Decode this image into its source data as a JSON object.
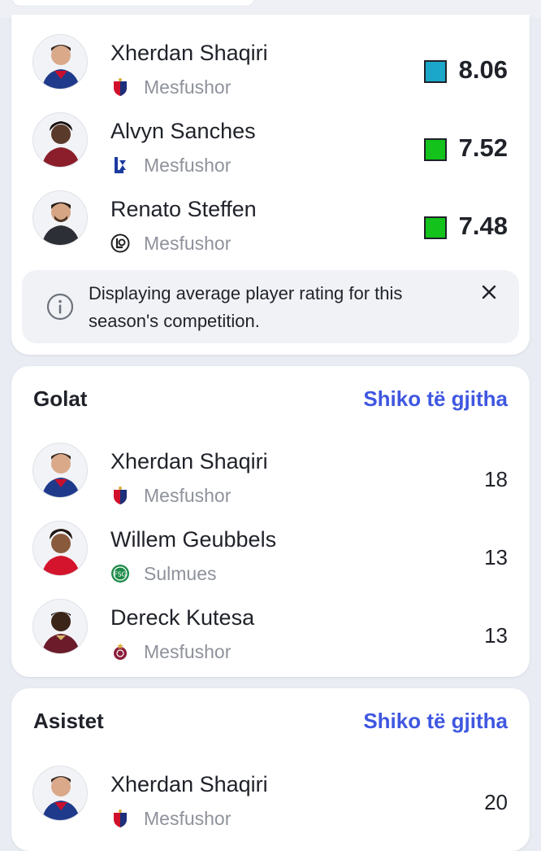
{
  "colors": {
    "accent": "#3f57e0",
    "rating_blue": "#1aa7c9",
    "rating_green": "#13c21b"
  },
  "rating_card": {
    "players": [
      {
        "name": "Xherdan Shaqiri",
        "position": "Mesfushor",
        "rating": "8.06",
        "rating_color": "#1aa7c9",
        "badge": "basel-badge-icon"
      },
      {
        "name": "Alvyn Sanches",
        "position": "Mesfushor",
        "rating": "7.52",
        "rating_color": "#13c21b",
        "badge": "lausanne-badge-icon"
      },
      {
        "name": "Renato Steffen",
        "position": "Mesfushor",
        "rating": "7.48",
        "rating_color": "#13c21b",
        "badge": "lugano-badge-icon"
      }
    ],
    "info_text": "Displaying average player rating for this season's competition.",
    "info_icon": "info-icon",
    "close_icon": "close-icon"
  },
  "goals_card": {
    "title": "Golat",
    "see_all": "Shiko të gjitha",
    "players": [
      {
        "name": "Xherdan Shaqiri",
        "position": "Mesfushor",
        "value": "18",
        "badge": "basel-badge-icon"
      },
      {
        "name": "Willem Geubbels",
        "position": "Sulmues",
        "value": "13",
        "badge": "stgallen-badge-icon"
      },
      {
        "name": "Dereck Kutesa",
        "position": "Mesfushor",
        "value": "13",
        "badge": "servette-badge-icon"
      }
    ]
  },
  "assists_card": {
    "title": "Asistet",
    "see_all": "Shiko të gjitha",
    "players": [
      {
        "name": "Xherdan Shaqiri",
        "position": "Mesfushor",
        "value": "20",
        "badge": "basel-badge-icon"
      }
    ]
  }
}
